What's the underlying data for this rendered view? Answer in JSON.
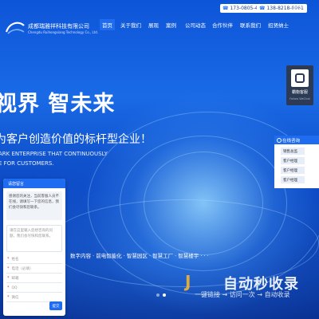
{
  "header": {
    "company_cn": "成都瑞雅祥科技有限公司",
    "company_en": "Chengdu Ruihongxiang Technology Co., Ltd.",
    "phone1": "173-0805-4161",
    "phone2": "138-8218-0961",
    "language": "中文 ⌄"
  },
  "nav": {
    "items": [
      "首页",
      "关于我们",
      "展现",
      "案例",
      "公司动态",
      "合作伙伴",
      "联系我们",
      "招贤纳士"
    ],
    "active": "首页"
  },
  "hero": {
    "headline": "视界  智未来",
    "subline": "为客户创造价值的标杆型企业！",
    "en_line1": "ARK ENTERPRISE THAT CONTINUOUSLY",
    "en_line2": "E FOR CUSTOMERS."
  },
  "services": {
    "text": "数字内容  ·  前电智能化  ·  智慧园区  ·  智慧工厂  ·  智慧楼宇  · · ·"
  },
  "widget": {
    "qr_label": "霸衡客服",
    "qr_sub": "Follow WeChat",
    "online_title": "在线咨询",
    "agents": [
      "销售总监",
      "客户经理",
      "客户经理",
      "客户经理"
    ]
  },
  "chat": {
    "title": "请您留言",
    "greeting": "感谢您的关注，当前客服人员不在线，请填写一下您的信息，我们会尽快和您联系。",
    "message_placeholder": "请在这里输入您想咨询的问题，我们会尽快和您联系。",
    "fields": [
      "姓名",
      "电话（必填）",
      "邮箱",
      "QQ",
      "微信"
    ],
    "send": "提交"
  },
  "watermark": {
    "logo": "J",
    "title": "自动秒收录",
    "subtitle": "一键链接 → 访问一次 → 自动收录"
  },
  "colors": {
    "accent": "#1f6cf0",
    "hero_dark": "#082e8e"
  }
}
